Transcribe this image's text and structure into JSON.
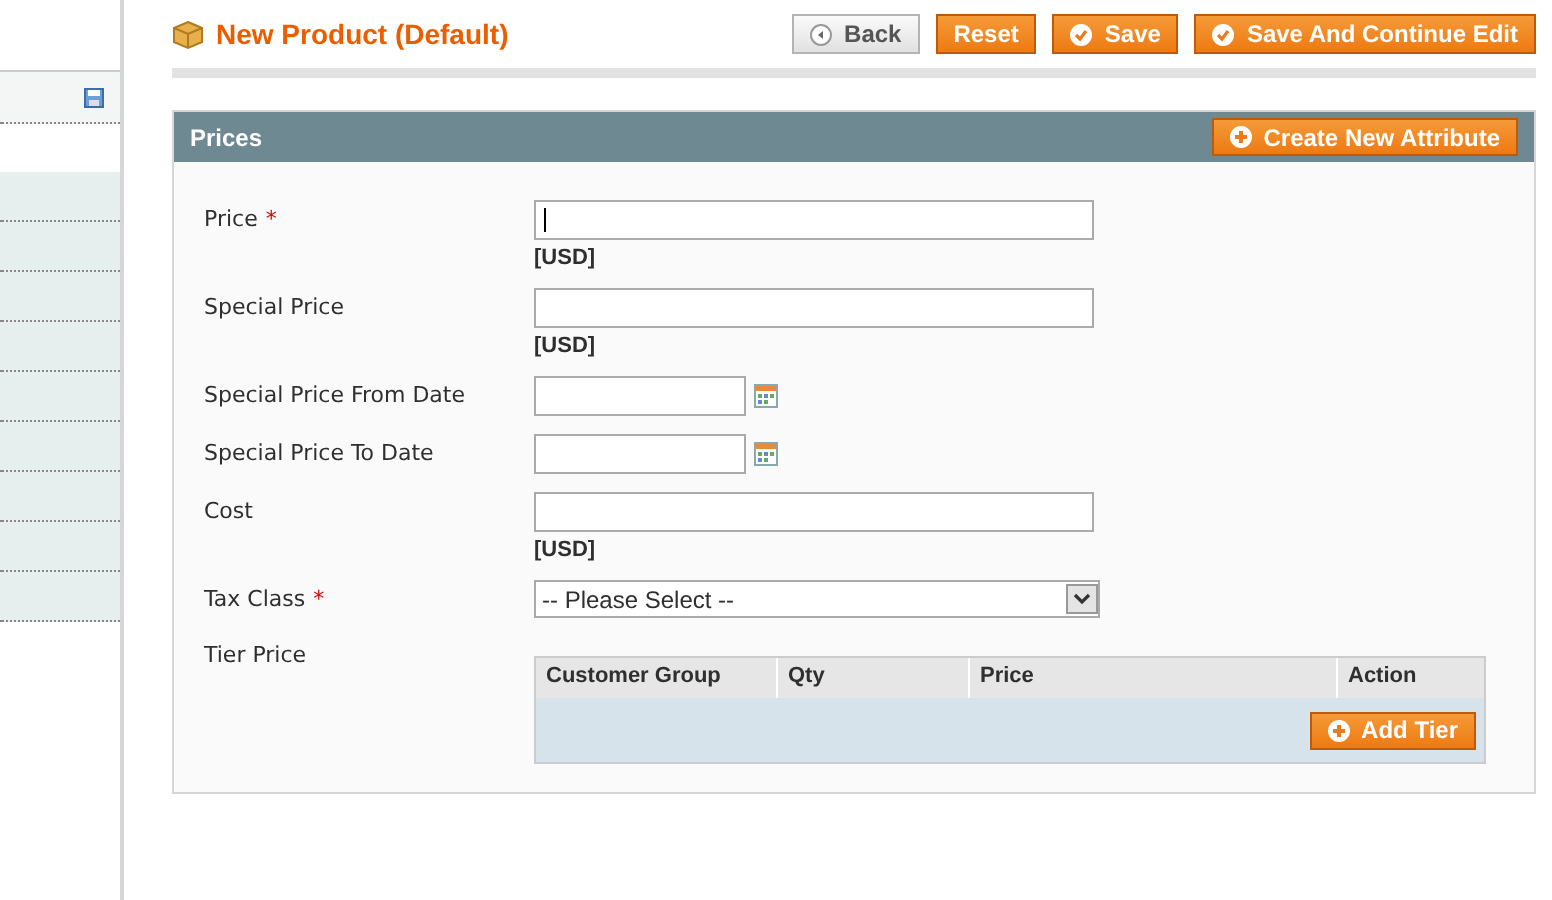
{
  "page_title": "New Product (Default)",
  "header_buttons": [
    {
      "label": "Back",
      "kind": "back"
    },
    {
      "label": "Reset",
      "kind": "plain"
    },
    {
      "label": "Save",
      "kind": "check"
    },
    {
      "label": "Save And Continue Edit",
      "kind": "check"
    }
  ],
  "sidebar": {
    "tabs": [
      {
        "kind": "save",
        "selected": true
      },
      {
        "kind": "plain",
        "selected": false
      },
      {
        "kind": "plain",
        "selected": false
      },
      {
        "kind": "plain",
        "selected": false
      },
      {
        "kind": "plain",
        "selected": false
      },
      {
        "kind": "plain",
        "selected": false
      },
      {
        "kind": "plain",
        "selected": false
      },
      {
        "kind": "plain",
        "selected": false
      },
      {
        "kind": "plain",
        "selected": false
      },
      {
        "kind": "plain",
        "selected": false
      }
    ]
  },
  "section": {
    "title": "Prices",
    "action": "Create New Attribute"
  },
  "fields": [
    {
      "label": "Price",
      "required_mark": "*",
      "kind": "text",
      "cursor": true,
      "note": "[USD]"
    },
    {
      "label": "Special Price",
      "kind": "text",
      "note": "[USD]"
    },
    {
      "label": "Special Price From Date",
      "kind": "date"
    },
    {
      "label": "Special Price To Date",
      "kind": "date"
    },
    {
      "label": "Cost",
      "kind": "text",
      "note": "[USD]"
    },
    {
      "label": "Tax Class",
      "required_mark": "*",
      "kind": "select",
      "value": "-- Please Select --"
    },
    {
      "label": "Tier Price",
      "kind": "tier",
      "columns": [
        "Customer Group",
        "Qty",
        "Price",
        "Action"
      ],
      "button": "Add Tier"
    }
  ]
}
